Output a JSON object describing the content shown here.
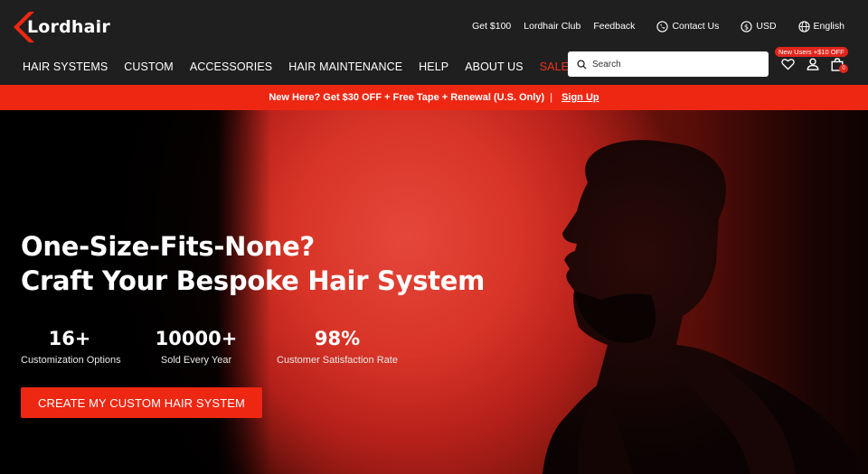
{
  "brand": {
    "name": "Lordhair",
    "accent_color": "#ee2712",
    "dark_bg": "#1f1f1f"
  },
  "topbar": {
    "get_offer": "Get $100",
    "club": "Lordhair Club",
    "feedback": "Feedback",
    "contact": {
      "label": "Contact Us",
      "icon": "phone-icon"
    },
    "currency": {
      "label": "USD",
      "icon": "dollar-circle-icon"
    },
    "language": {
      "label": "English",
      "icon": "globe-icon"
    }
  },
  "nav": {
    "items": [
      {
        "label": "HAIR SYSTEMS"
      },
      {
        "label": "CUSTOM"
      },
      {
        "label": "ACCESSORIES"
      },
      {
        "label": "HAIR MAINTENANCE"
      },
      {
        "label": "HELP"
      },
      {
        "label": "ABOUT US"
      },
      {
        "label": "SALE",
        "color": "#f0321c"
      }
    ]
  },
  "search": {
    "placeholder": "Search",
    "icon": "search-icon"
  },
  "header_icons": {
    "promo_badge": "New Users +$10 OFF",
    "wishlist_icon": "heart-icon",
    "account_icon": "user-icon",
    "cart_icon": "bag-icon",
    "cart_count": "0"
  },
  "announcement": {
    "text": "New Here? Get $30 OFF + Free Tape + Renewal (U.S. Only)",
    "separator": "|",
    "link": "Sign Up"
  },
  "hero": {
    "title_line1": "One-Size-Fits-None?",
    "title_line2": "Craft Your Bespoke Hair System",
    "stats": [
      {
        "value": "16+",
        "label": "Customization Options"
      },
      {
        "value": "10000+",
        "label": "Sold Every Year"
      },
      {
        "value": "98%",
        "label": "Customer Satisfaction Rate"
      }
    ],
    "cta_label": "CREATE MY CUSTOM HAIR SYSTEM"
  }
}
